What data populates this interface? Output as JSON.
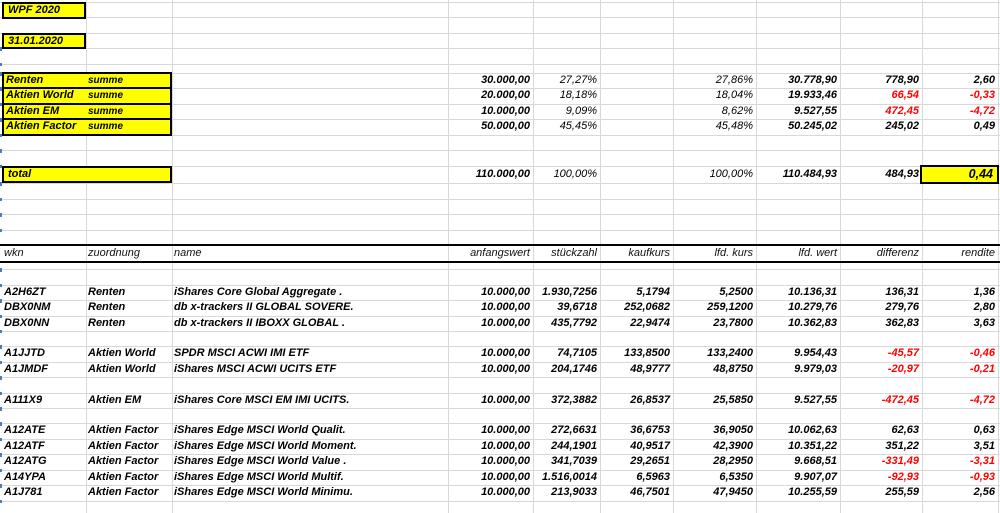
{
  "colors": {
    "highlight": "#ffff00",
    "negative": "#ff0000",
    "text": "#000000",
    "gridline": "#d8d8d8"
  },
  "title_box": "WPF 2020",
  "date_box": "31.01.2020",
  "summary": {
    "rows": [
      {
        "label": "Renten",
        "sub": "summe",
        "anfangswert": "30.000,00",
        "anteil_soll": "27,27%",
        "anteil_ist": "27,86%",
        "wert": "30.778,90",
        "differenz": "778,90",
        "rendite": "2,60",
        "diff_red": false,
        "rend_red": false
      },
      {
        "label": "Aktien World",
        "sub": "summe",
        "anfangswert": "20.000,00",
        "anteil_soll": "18,18%",
        "anteil_ist": "18,04%",
        "wert": "19.933,46",
        "differenz": "66,54",
        "rendite": "-0,33",
        "diff_red": true,
        "rend_red": true
      },
      {
        "label": "Aktien EM",
        "sub": "summe",
        "anfangswert": "10.000,00",
        "anteil_soll": "9,09%",
        "anteil_ist": "8,62%",
        "wert": "9.527,55",
        "differenz": "472,45",
        "rendite": "-4,72",
        "diff_red": true,
        "rend_red": true
      },
      {
        "label": "Aktien Factor",
        "sub": "summe",
        "anfangswert": "50.000,00",
        "anteil_soll": "45,45%",
        "anteil_ist": "45,48%",
        "wert": "50.245,02",
        "differenz": "245,02",
        "rendite": "0,49",
        "diff_red": false,
        "rend_red": false
      }
    ]
  },
  "total": {
    "label": "total",
    "anfangswert": "110.000,00",
    "anteil_soll": "100,00%",
    "anteil_ist": "100,00%",
    "wert": "110.484,93",
    "differenz": "484,93",
    "rendite": "0,44"
  },
  "table": {
    "headers": {
      "wkn": "wkn",
      "zuordnung": "zuordnung",
      "name": "name",
      "anfangswert": "anfangswert",
      "stueckzahl": "stückzahl",
      "kaufkurs": "kaufkurs",
      "lfd_kurs": "lfd. kurs",
      "lfd_wert": "lfd. wert",
      "differenz": "differenz",
      "rendite": "rendite"
    },
    "rows": [
      {
        "wkn": "A2H6ZT",
        "zuordnung": "Renten",
        "name": "iShares Core Global Aggregate .",
        "anfangswert": "10.000,00",
        "stueckzahl": "1.930,7256",
        "kaufkurs": "5,1794",
        "lfd_kurs": "5,2500",
        "lfd_wert": "10.136,31",
        "differenz": "136,31",
        "rendite": "1,36",
        "diff_red": false,
        "rend_red": false
      },
      {
        "wkn": "DBX0NM",
        "zuordnung": "Renten",
        "name": "db x-trackers II GLOBAL SOVERE.",
        "anfangswert": "10.000,00",
        "stueckzahl": "39,6718",
        "kaufkurs": "252,0682",
        "lfd_kurs": "259,1200",
        "lfd_wert": "10.279,76",
        "differenz": "279,76",
        "rendite": "2,80",
        "diff_red": false,
        "rend_red": false
      },
      {
        "wkn": "DBX0NN",
        "zuordnung": "Renten",
        "name": "db x-trackers II IBOXX GLOBAL .",
        "anfangswert": "10.000,00",
        "stueckzahl": "435,7792",
        "kaufkurs": "22,9474",
        "lfd_kurs": "23,7800",
        "lfd_wert": "10.362,83",
        "differenz": "362,83",
        "rendite": "3,63",
        "diff_red": false,
        "rend_red": false
      },
      {
        "spacer": true
      },
      {
        "wkn": "A1JJTD",
        "zuordnung": "Aktien World",
        "name": "SPDR MSCI ACWI IMI ETF",
        "anfangswert": "10.000,00",
        "stueckzahl": "74,7105",
        "kaufkurs": "133,8500",
        "lfd_kurs": "133,2400",
        "lfd_wert": "9.954,43",
        "differenz": "-45,57",
        "rendite": "-0,46",
        "diff_red": true,
        "rend_red": true
      },
      {
        "wkn": "A1JMDF",
        "zuordnung": "Aktien World",
        "name": "iShares MSCI ACWI UCITS ETF",
        "anfangswert": "10.000,00",
        "stueckzahl": "204,1746",
        "kaufkurs": "48,9777",
        "lfd_kurs": "48,8750",
        "lfd_wert": "9.979,03",
        "differenz": "-20,97",
        "rendite": "-0,21",
        "diff_red": true,
        "rend_red": true
      },
      {
        "spacer": true
      },
      {
        "wkn": "A111X9",
        "zuordnung": "Aktien EM",
        "name": "iShares Core MSCI EM IMI UCITS.",
        "anfangswert": "10.000,00",
        "stueckzahl": "372,3882",
        "kaufkurs": "26,8537",
        "lfd_kurs": "25,5850",
        "lfd_wert": "9.527,55",
        "differenz": "-472,45",
        "rendite": "-4,72",
        "diff_red": true,
        "rend_red": true
      },
      {
        "spacer": true
      },
      {
        "wkn": "A12ATE",
        "zuordnung": "Aktien Factor",
        "name": "iShares Edge MSCI World Qualit.",
        "anfangswert": "10.000,00",
        "stueckzahl": "272,6631",
        "kaufkurs": "36,6753",
        "lfd_kurs": "36,9050",
        "lfd_wert": "10.062,63",
        "differenz": "62,63",
        "rendite": "0,63",
        "diff_red": false,
        "rend_red": false
      },
      {
        "wkn": "A12ATF",
        "zuordnung": "Aktien Factor",
        "name": "iShares Edge MSCI World Moment.",
        "anfangswert": "10.000,00",
        "stueckzahl": "244,1901",
        "kaufkurs": "40,9517",
        "lfd_kurs": "42,3900",
        "lfd_wert": "10.351,22",
        "differenz": "351,22",
        "rendite": "3,51",
        "diff_red": false,
        "rend_red": false
      },
      {
        "wkn": "A12ATG",
        "zuordnung": "Aktien Factor",
        "name": "iShares Edge MSCI World Value .",
        "anfangswert": "10.000,00",
        "stueckzahl": "341,7039",
        "kaufkurs": "29,2651",
        "lfd_kurs": "28,2950",
        "lfd_wert": "9.668,51",
        "differenz": "-331,49",
        "rendite": "-3,31",
        "diff_red": true,
        "rend_red": true
      },
      {
        "wkn": "A14YPA",
        "zuordnung": "Aktien Factor",
        "name": "iShares Edge MSCI World Multif.",
        "anfangswert": "10.000,00",
        "stueckzahl": "1.516,0014",
        "kaufkurs": "6,5963",
        "lfd_kurs": "6,5350",
        "lfd_wert": "9.907,07",
        "differenz": "-92,93",
        "rendite": "-0,93",
        "diff_red": true,
        "rend_red": true
      },
      {
        "wkn": "A1J781",
        "zuordnung": "Aktien Factor",
        "name": "iShares Edge MSCI World Minimu.",
        "anfangswert": "10.000,00",
        "stueckzahl": "213,9033",
        "kaufkurs": "46,7501",
        "lfd_kurs": "47,9450",
        "lfd_wert": "10.255,59",
        "differenz": "255,59",
        "rendite": "2,56",
        "diff_red": false,
        "rend_red": false
      }
    ]
  }
}
